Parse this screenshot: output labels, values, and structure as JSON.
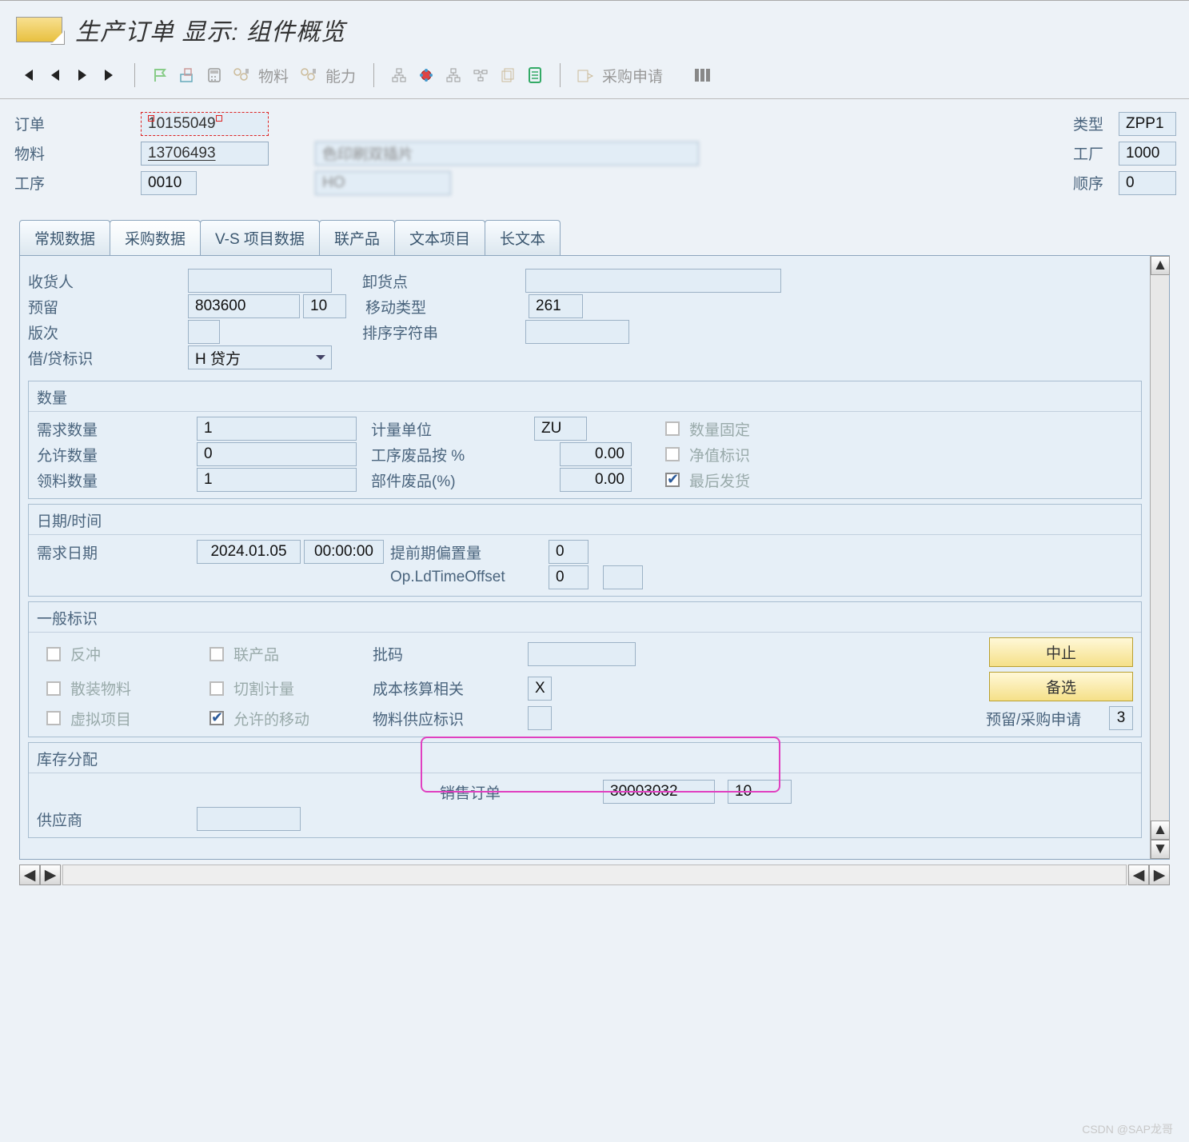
{
  "title": "生产订单 显示: 组件概览",
  "toolbar": {
    "material_label": "物料",
    "capacity_label": "能力",
    "purchase_req_label": "采购申请"
  },
  "header": {
    "order_label": "订单",
    "order": "10155049",
    "type_label": "类型",
    "type": "ZPP1",
    "material_label": "物料",
    "material": "13706493",
    "material_desc": "  色印刷双插片 ",
    "plant_label": "工厂",
    "plant": "1000",
    "operation_label": "工序",
    "operation": "0010",
    "op_desc": "HO",
    "sequence_label": "顺序",
    "sequence": "0"
  },
  "tabs": [
    "常规数据",
    "采购数据",
    "V-S 项目数据",
    "联产品",
    "文本项目",
    "长文本"
  ],
  "purchase_data": {
    "recipient_label": "收货人",
    "recipient": "",
    "unload_label": "卸货点",
    "unload": "",
    "reservation_label": "预留",
    "reservation": "803600",
    "reservation_item": "10",
    "movement_type_label": "移动类型",
    "movement_type": "261",
    "revision_label": "版次",
    "revision": "",
    "sort_string_label": "排序字符串",
    "sort_string": "",
    "debit_credit_label": "借/贷标识",
    "debit_credit": "H 贷方"
  },
  "quantity": {
    "title": "数量",
    "req_qty_label": "需求数量",
    "req_qty": "1",
    "uom_label": "计量单位",
    "uom": "ZU",
    "fixed_label": "数量固定",
    "allowed_label": "允许数量",
    "allowed": "0",
    "op_scrap_label": "工序废品按 %",
    "op_scrap": "0.00",
    "net_label": "净值标识",
    "withdrawn_label": "领料数量",
    "withdrawn": "1",
    "comp_scrap_label": "部件废品(%)",
    "comp_scrap": "0.00",
    "final_label": "最后发货"
  },
  "datetime": {
    "title": "日期/时间",
    "req_date_label": "需求日期",
    "req_date": "2024.01.05",
    "req_time": "00:00:00",
    "lead_offset_label": "提前期偏置量",
    "lead_offset": "0",
    "op_ld_label": "Op.LdTimeOffset",
    "op_ld": "0"
  },
  "general": {
    "title": "一般标识",
    "backflush_label": "反冲",
    "coproduct_label": "联产品",
    "batch_label": "批码",
    "batch": "",
    "abort_btn": "中止",
    "bulk_label": "散装物料",
    "cut_label": "切割计量",
    "cost_rel_label": "成本核算相关",
    "cost_rel": "X",
    "alt_btn": "备选",
    "phantom_label": "虚拟项目",
    "allowed_mvt_label": "允许的移动",
    "supply_label": "物料供应标识",
    "supply": "",
    "res_purch_label": "预留/采购申请",
    "res_purch": "3"
  },
  "stock": {
    "title": "库存分配",
    "sales_order_label": "销售订单",
    "sales_order": "30003032",
    "sales_item": "10",
    "vendor_label": "供应商",
    "vendor": ""
  },
  "watermark": "CSDN @SAP龙哥"
}
